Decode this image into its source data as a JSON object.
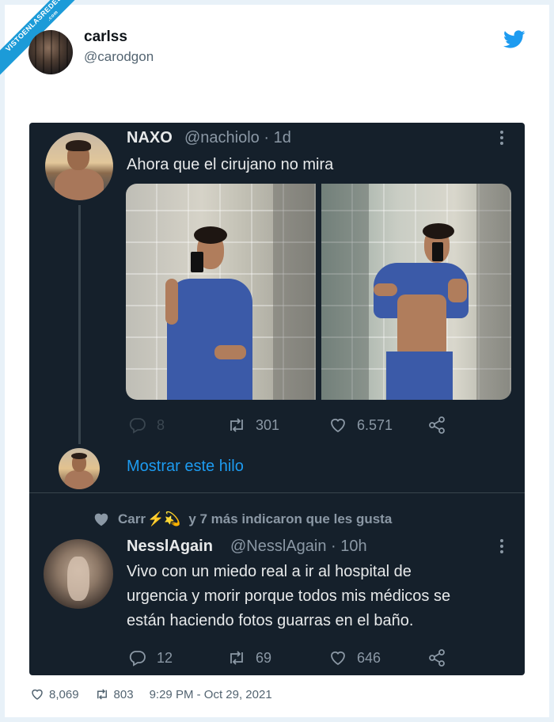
{
  "watermark": {
    "text": "VISTOENLASREDES",
    "sub": ".com"
  },
  "outer_tweet": {
    "name": "carlss",
    "handle": "@carodgon",
    "brand_color": "#1d9bf0",
    "icon": "twitter-bird-icon"
  },
  "screenshot": {
    "background": "#15202b",
    "tweet1": {
      "name": "NAXO",
      "handle_time": "@nachiolo · 1d",
      "text": "Ahora que el cirujano no mira",
      "replies": "8",
      "retweets": "301",
      "likes": "6.571"
    },
    "show_thread": "Mostrar este hilo",
    "liked_by": {
      "prefix": "Carr",
      "emoji": "⚡💫",
      "suffix": "y 7 más indicaron que les gusta"
    },
    "tweet2": {
      "name": "NesslAgain",
      "handle_time": "@NesslAgain · 10h",
      "text_lines": [
        "Vivo con un miedo real a ir al hospital de",
        "urgencia y morir porque todos mis médicos se",
        "están haciendo fotos guarras en el baño."
      ],
      "replies": "12",
      "retweets": "69",
      "likes": "646"
    }
  },
  "footer": {
    "likes": "8,069",
    "retweets": "803",
    "timestamp": "9:29 PM - Oct 29, 2021"
  }
}
